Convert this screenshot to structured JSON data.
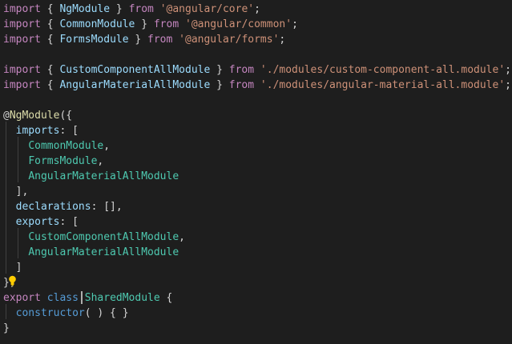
{
  "theme": {
    "background": "#1e1e1e",
    "colors": {
      "keyword": "#c586c0",
      "keyword_blue": "#569cd6",
      "class": "#4ec9b0",
      "variable": "#9cdcfe",
      "function": "#dcdcaa",
      "string": "#ce9178",
      "punct": "#d4d4d4",
      "bracket": "#d4d4d4",
      "lightbulb": "#ffcc00"
    }
  },
  "editor": {
    "lines": [
      [
        [
          "import",
          "keyword"
        ],
        [
          " { ",
          "punct"
        ],
        [
          "NgModule",
          "variable"
        ],
        [
          " } ",
          "punct"
        ],
        [
          "from",
          "keyword"
        ],
        [
          " ",
          "punct"
        ],
        [
          "'@angular/core'",
          "string"
        ],
        [
          ";",
          "punct"
        ]
      ],
      [
        [
          "import",
          "keyword"
        ],
        [
          " { ",
          "punct"
        ],
        [
          "CommonModule",
          "variable"
        ],
        [
          " } ",
          "punct"
        ],
        [
          "from",
          "keyword"
        ],
        [
          " ",
          "punct"
        ],
        [
          "'@angular/common'",
          "string"
        ],
        [
          ";",
          "punct"
        ]
      ],
      [
        [
          "import",
          "keyword"
        ],
        [
          " { ",
          "punct"
        ],
        [
          "FormsModule",
          "variable"
        ],
        [
          " } ",
          "punct"
        ],
        [
          "from",
          "keyword"
        ],
        [
          " ",
          "punct"
        ],
        [
          "'@angular/forms'",
          "string"
        ],
        [
          ";",
          "punct"
        ]
      ],
      [],
      [
        [
          "import",
          "keyword"
        ],
        [
          " { ",
          "punct"
        ],
        [
          "CustomComponentAllModule",
          "variable"
        ],
        [
          " } ",
          "punct"
        ],
        [
          "from",
          "keyword"
        ],
        [
          " ",
          "punct"
        ],
        [
          "'./modules/custom-component-all.module'",
          "string"
        ],
        [
          ";",
          "punct"
        ]
      ],
      [
        [
          "import",
          "keyword"
        ],
        [
          " { ",
          "punct"
        ],
        [
          "AngularMaterialAllModule",
          "variable"
        ],
        [
          " } ",
          "punct"
        ],
        [
          "from",
          "keyword"
        ],
        [
          " ",
          "punct"
        ],
        [
          "'./modules/angular-material-all.module'",
          "string"
        ],
        [
          ";",
          "punct"
        ]
      ],
      [],
      [
        [
          "@",
          "punct"
        ],
        [
          "NgModule",
          "function"
        ],
        [
          "({",
          "punct"
        ]
      ],
      [
        [
          "  ",
          "punct"
        ],
        [
          "imports",
          "variable"
        ],
        [
          ": [",
          "punct"
        ]
      ],
      [
        [
          "    ",
          "punct"
        ],
        [
          "CommonModule",
          "class"
        ],
        [
          ",",
          "punct"
        ]
      ],
      [
        [
          "    ",
          "punct"
        ],
        [
          "FormsModule",
          "class"
        ],
        [
          ",",
          "punct"
        ]
      ],
      [
        [
          "    ",
          "punct"
        ],
        [
          "AngularMaterialAllModule",
          "class"
        ]
      ],
      [
        [
          "  ],",
          "punct"
        ]
      ],
      [
        [
          "  ",
          "punct"
        ],
        [
          "declarations",
          "variable"
        ],
        [
          ": [],",
          "punct"
        ]
      ],
      [
        [
          "  ",
          "punct"
        ],
        [
          "exports",
          "variable"
        ],
        [
          ": [",
          "punct"
        ]
      ],
      [
        [
          "    ",
          "punct"
        ],
        [
          "CustomComponentAllModule",
          "class"
        ],
        [
          ",",
          "punct"
        ]
      ],
      [
        [
          "    ",
          "punct"
        ],
        [
          "AngularMaterialAllModule",
          "class"
        ]
      ],
      [
        [
          "  ]",
          "punct"
        ]
      ],
      [
        [
          "})",
          "punct"
        ]
      ],
      [
        [
          "export",
          "keyword"
        ],
        [
          " ",
          "punct"
        ],
        [
          "class",
          "keyword_blue"
        ],
        [
          " ",
          "punct"
        ],
        [
          "SharedModule",
          "class"
        ],
        [
          " {",
          "punct"
        ]
      ],
      [
        [
          "  ",
          "punct"
        ],
        [
          "constructor",
          "keyword_blue"
        ],
        [
          "( ) { }",
          "punct"
        ]
      ],
      [
        [
          "}",
          "punct"
        ]
      ]
    ],
    "lightbulb_icon": "lightbulb-icon"
  }
}
